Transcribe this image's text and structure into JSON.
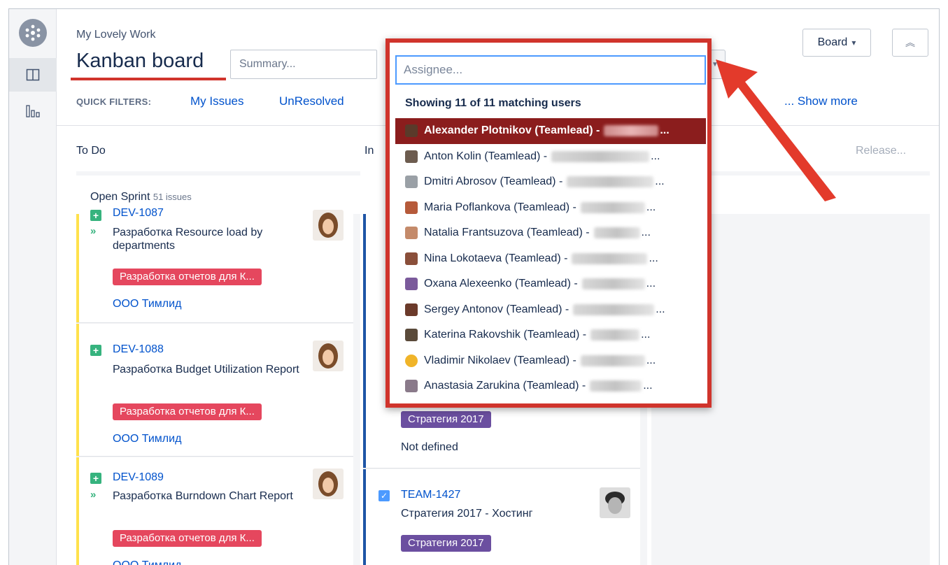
{
  "header": {
    "project_name": "My Lovely Work",
    "board_title": "Kanban board",
    "summary_placeholder": "Summary...",
    "board_button": "Board",
    "board_caret": "▾",
    "collapse_glyph": "︽"
  },
  "quick_filters": {
    "label": "QUICK FILTERS:",
    "items": [
      "My Issues",
      "UnResolved"
    ],
    "show_more": "... Show more"
  },
  "columns": [
    {
      "name": "To Do"
    },
    {
      "name": "In"
    }
  ],
  "release_link": "Release...",
  "sprint": {
    "name": "Open Sprint",
    "count": "51 issues"
  },
  "cards_col1": [
    {
      "key": "DEV-1087",
      "summary": "Разработка Resource load by departments",
      "epic": "Разработка отчетов для К...",
      "company": "ООО Тимлид"
    },
    {
      "key": "DEV-1088",
      "summary": "Разработка Budget Utilization Report",
      "epic": "Разработка отчетов для К...",
      "company": "ООО Тимлид"
    },
    {
      "key": "DEV-1089",
      "summary": "Разработка Burndown Chart Report",
      "epic": "Разработка отчетов для К...",
      "company": "ООО Тимлид"
    }
  ],
  "cards_col2": [
    {
      "epic": "Стратегия 2017",
      "extra": "Not defined"
    },
    {
      "key": "TEAM-1427",
      "summary": "Стратегия 2017 - Хостинг",
      "epic": "Стратегия 2017"
    }
  ],
  "dropdown": {
    "placeholder": "Assignee...",
    "status": "Showing 11 of 11 matching users",
    "users": [
      "Alexander Plotnikov (Teamlead) -",
      "Anton Kolin (Teamlead) -",
      "Dmitri Abrosov (Teamlead) -",
      "Maria Poflankova (Teamlead) -",
      "Natalia Frantsuzova (Teamlead) -",
      "Nina Lokotaeva (Teamlead) -",
      "Oxana Alexeenko (Teamlead) -",
      "Sergey Antonov (Teamlead) -",
      "Katerina Rakovshik (Teamlead) -",
      "Vladimir Nikolaev (Teamlead) -",
      "Anastasia Zarukina (Teamlead) -"
    ],
    "ellipsis": "..."
  },
  "colors": {
    "accent_red": "#d0342c",
    "link_blue": "#0052cc",
    "epic_pink": "#e5475e",
    "epic_purple": "#6b4fa0",
    "lead_yellow": "#ffe14c",
    "lead_blue": "#1e55a6",
    "story_green": "#36b37e",
    "task_blue": "#4c9aff"
  }
}
